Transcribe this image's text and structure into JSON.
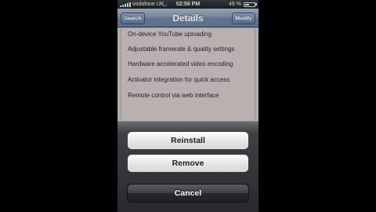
{
  "status_bar": {
    "carrier": "vodafone UK",
    "time": "02:56 PM",
    "battery_percent": "49 %",
    "battery_level": 0.49,
    "icons": [
      "signal-icon",
      "wifi-icon",
      "battery-icon"
    ]
  },
  "nav": {
    "title": "Details",
    "back_label": "Search",
    "action_label": "Modify"
  },
  "features": [
    "On-device YouTube uploading",
    "Adjustable framerate & quality settings",
    "Hardware accelerated video encoding",
    "Activator integration for quick access",
    "Remote control via web interface"
  ],
  "action_sheet": {
    "reinstall_label": "Reinstall",
    "remove_label": "Remove",
    "cancel_label": "Cancel"
  },
  "colors": {
    "nav_bar": "#7e92ab",
    "sheet_background": "#2a2c30",
    "cancel_button": "#3a3c40"
  }
}
